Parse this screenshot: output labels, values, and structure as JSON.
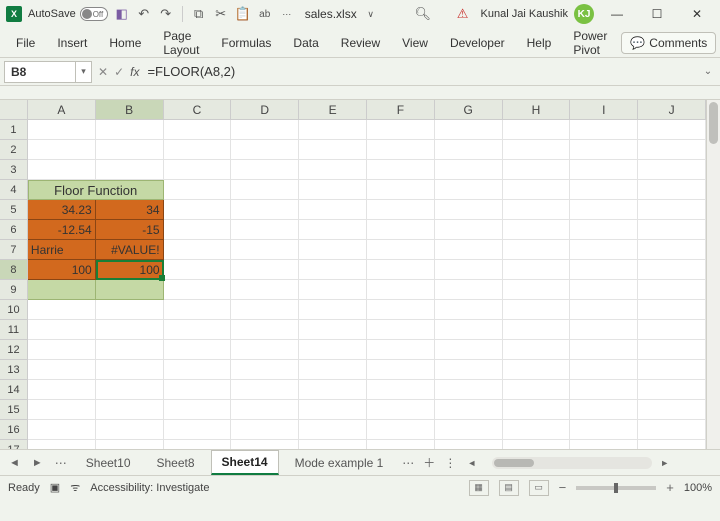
{
  "titlebar": {
    "app_icon_label": "X",
    "autosave_label": "AutoSave",
    "autosave_off": "Off",
    "filename": "sales.xlsx",
    "filename_dropdown": "∨",
    "user_name": "Kunal Jai Kaushik",
    "avatar_initials": "KJ"
  },
  "ribbon": {
    "tabs": [
      "File",
      "Insert",
      "Home",
      "Page Layout",
      "Formulas",
      "Data",
      "Review",
      "View",
      "Developer",
      "Help",
      "Power Pivot"
    ],
    "comments_label": "Comments"
  },
  "formula_bar": {
    "name_box": "B8",
    "formula": "=FLOOR(A8,2)"
  },
  "grid": {
    "columns": [
      "A",
      "B",
      "C",
      "D",
      "E",
      "F",
      "G",
      "H",
      "I",
      "J"
    ],
    "row_count": 17,
    "merged_header": {
      "row": 4,
      "colspan": 2,
      "text": "Floor Function"
    },
    "cells": {
      "A5": "34.23",
      "B5": "34",
      "A6": "-12.54",
      "B6": "-15",
      "A7": "Harrie",
      "B7": "#VALUE!",
      "A8": "100",
      "B8": "100"
    },
    "selected_cell": "B8",
    "selected_row": 8,
    "selected_col": "B"
  },
  "sheet_tabs": {
    "tabs": [
      "Sheet10",
      "Sheet8",
      "Sheet14",
      "Mode example 1"
    ],
    "active": "Sheet14"
  },
  "status": {
    "ready": "Ready",
    "accessibility": "Accessibility: Investigate",
    "zoom": "100%"
  }
}
